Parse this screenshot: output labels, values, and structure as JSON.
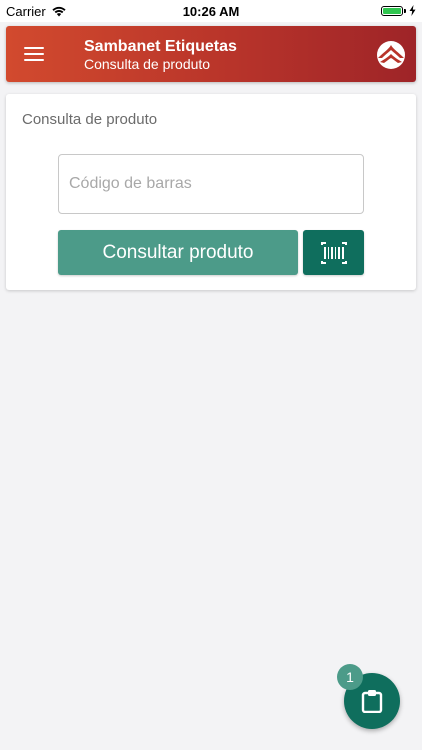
{
  "status_bar": {
    "carrier": "Carrier",
    "time": "10:26 AM"
  },
  "app_bar": {
    "title": "Sambanet Etiquetas",
    "subtitle": "Consulta de produto",
    "menu_icon": "hamburger-menu-icon",
    "logo_icon": "sambanet-logo-icon"
  },
  "card": {
    "title": "Consulta de produto",
    "barcode_input": {
      "placeholder": "Código de barras",
      "value": ""
    },
    "consult_button_label": "Consultar produto",
    "scan_button_icon": "barcode-scan-icon"
  },
  "fab": {
    "icon": "clipboard-icon",
    "badge_count": "1"
  },
  "colors": {
    "app_bar_start": "#d24a2e",
    "app_bar_end": "#9e2428",
    "primary_button": "#4c9b89",
    "dark_green": "#0f6e5d",
    "background": "#f3f3f5"
  }
}
